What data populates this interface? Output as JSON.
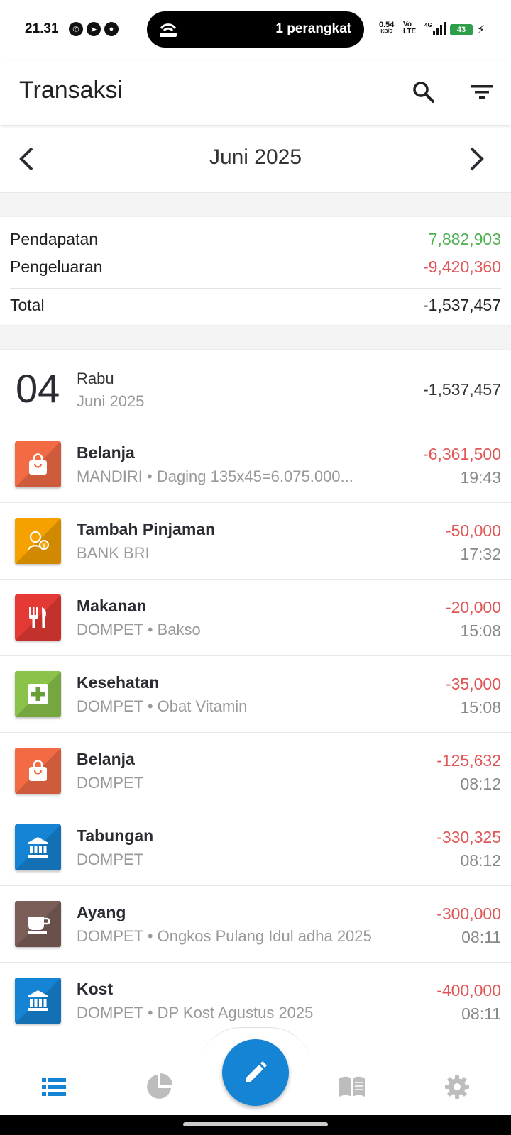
{
  "status_bar": {
    "time": "21.31",
    "pill_text": "1 perangkat",
    "net_speed": "0.54",
    "net_unit": "KB/S",
    "volte_top": "Vo",
    "volte_bottom": "LTE",
    "battery": "43"
  },
  "app_bar": {
    "title": "Transaksi"
  },
  "month_nav": {
    "label": "Juni 2025"
  },
  "summary": {
    "income_label": "Pendapatan",
    "income_value": "7,882,903",
    "expense_label": "Pengeluaran",
    "expense_value": "-9,420,360",
    "total_label": "Total",
    "total_value": "-1,537,457"
  },
  "day_group": {
    "day_number": "04",
    "day_name": "Rabu",
    "month_year": "Juni 2025",
    "total": "-1,537,457"
  },
  "transactions": [
    {
      "title": "Belanja",
      "subtitle": "MANDIRI • Daging 135x45=6.075.000...",
      "amount": "-6,361,500",
      "time": "19:43",
      "icon": "shopping-bag-icon",
      "color": "#f26b45"
    },
    {
      "title": "Tambah Pinjaman",
      "subtitle": "BANK BRI",
      "amount": "-50,000",
      "time": "17:32",
      "icon": "loan-person-icon",
      "color": "#f5a100"
    },
    {
      "title": "Makanan",
      "subtitle": "DOMPET • Bakso",
      "amount": "-20,000",
      "time": "15:08",
      "icon": "fork-knife-icon",
      "color": "#e53935"
    },
    {
      "title": "Kesehatan",
      "subtitle": "DOMPET • Obat Vitamin",
      "amount": "-35,000",
      "time": "15:08",
      "icon": "medical-plus-icon",
      "color": "#8bc34a"
    },
    {
      "title": "Belanja",
      "subtitle": "DOMPET",
      "amount": "-125,632",
      "time": "08:12",
      "icon": "shopping-bag-icon",
      "color": "#f26b45"
    },
    {
      "title": "Tabungan",
      "subtitle": "DOMPET",
      "amount": "-330,325",
      "time": "08:12",
      "icon": "bank-icon",
      "color": "#1684d4"
    },
    {
      "title": "Ayang",
      "subtitle": "DOMPET • Ongkos Pulang Idul adha 2025",
      "amount": "-300,000",
      "time": "08:11",
      "icon": "coffee-cup-icon",
      "color": "#7b5e57"
    },
    {
      "title": "Kost",
      "subtitle": "DOMPET • DP Kost Agustus 2025",
      "amount": "-400,000",
      "time": "08:11",
      "icon": "bank-icon",
      "color": "#1684d4"
    }
  ],
  "colors": {
    "accent": "#1684d4",
    "income": "#4caf50",
    "expense": "#e05555"
  }
}
